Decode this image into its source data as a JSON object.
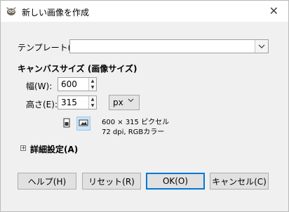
{
  "window": {
    "title": "新しい画像を作成",
    "close_label": "✕"
  },
  "template": {
    "label": "テンプレート(T):",
    "value": ""
  },
  "canvas_size": {
    "title": "キャンバスサイズ (画像サイズ)",
    "width_label": "幅(W):",
    "width_value": "600",
    "height_label": "高さ(E):",
    "height_value": "315",
    "unit": "px",
    "info_size": "600 × 315 ピクセル",
    "info_detail": "72 dpi, RGBカラー"
  },
  "advanced": {
    "expander_glyph": "+",
    "label": "詳細設定(A)"
  },
  "buttons": {
    "help": "ヘルプ(H)",
    "reset": "リセット(R)",
    "ok": "OK(O)",
    "cancel": "キャンセル(C)"
  },
  "colors": {
    "accent": "#0078d7",
    "window_bg": "#f0f0f0"
  }
}
